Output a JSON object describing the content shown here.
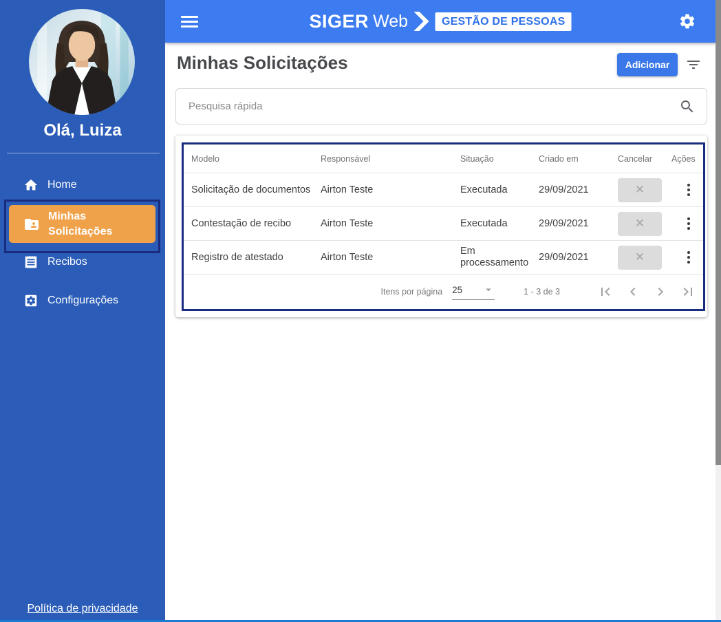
{
  "topbar": {
    "logo_primary": "SIGER",
    "logo_secondary": "Web",
    "badge": "GESTÃO DE PESSOAS"
  },
  "sidebar": {
    "greeting": "Olá, Luiza",
    "items": [
      {
        "label": "Home",
        "icon": "home-icon"
      },
      {
        "label": "Minhas Solicitações",
        "icon": "folder-shared-icon",
        "active": true
      },
      {
        "label": "Recibos",
        "icon": "receipt-icon"
      },
      {
        "label": "Configurações",
        "icon": "settings-applications-icon"
      }
    ],
    "privacy_link": "Política de privacidade"
  },
  "main": {
    "title": "Minhas Solicitações",
    "add_button_label": "Adicionar",
    "search_placeholder": "Pesquisa rápida"
  },
  "table": {
    "columns": [
      "Modelo",
      "Responsável",
      "Situação",
      "Criado em",
      "Cancelar",
      "Ações"
    ],
    "rows": [
      {
        "modelo": "Solicitação de documentos",
        "responsavel": "Airton Teste",
        "situacao": "Executada",
        "criado_em": "29/09/2021"
      },
      {
        "modelo": "Contestação de recibo",
        "responsavel": "Airton Teste",
        "situacao": "Executada",
        "criado_em": "29/09/2021"
      },
      {
        "modelo": "Registro de atestado",
        "responsavel": "Airton Teste",
        "situacao": "Em processamento",
        "criado_em": "29/09/2021"
      }
    ],
    "cancel_glyph": "✕",
    "pagination": {
      "items_per_page_label": "Itens por página",
      "items_per_page_value": "25",
      "range_label": "1 - 3 de 3"
    }
  },
  "colors": {
    "topbar_blue": "#3c7cf0",
    "sidebar_blue": "#2a5cb8",
    "active_orange": "#f0a24a",
    "annotation_navy": "#1a2c80",
    "button_blue": "#3a78ea",
    "bottom_strip_blue": "#1b7ad2"
  }
}
